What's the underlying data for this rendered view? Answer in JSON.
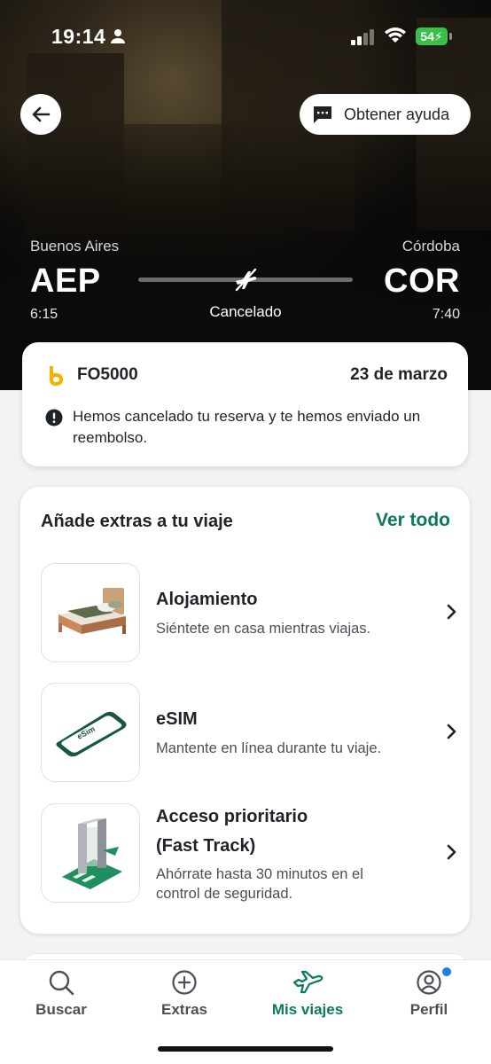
{
  "status_bar": {
    "time": "19:14",
    "battery": "54"
  },
  "header": {
    "help_label": "Obtener ayuda"
  },
  "route": {
    "from_city": "Buenos Aires",
    "from_code": "AEP",
    "from_time": "6:15",
    "to_city": "Córdoba",
    "to_code": "COR",
    "to_time": "7:40",
    "status": "Cancelado"
  },
  "booking": {
    "flight_number": "FO5000",
    "date": "23 de marzo",
    "message": "Hemos cancelado tu reserva y te hemos enviado un reembolso."
  },
  "extras": {
    "title": "Añade extras a tu viaje",
    "see_all": "Ver todo",
    "items": [
      {
        "name": "Alojamiento",
        "description": "Siéntete en casa mientras viajas.",
        "icon": "bed-icon"
      },
      {
        "name": "eSIM",
        "description": "Mantente en línea durante tu viaje.",
        "icon": "phone-esim-icon",
        "thumb_text": "eSim"
      },
      {
        "name_line1": "Acceso prioritario",
        "name_line2": "(Fast Track)",
        "description_line1": "Ahórrate hasta 30 minutos en el",
        "description_line2": "control de seguridad.",
        "icon": "security-gate-icon"
      }
    ]
  },
  "nav": {
    "items": [
      {
        "label": "Buscar",
        "icon": "search-icon"
      },
      {
        "label": "Extras",
        "icon": "plus-circle-icon"
      },
      {
        "label": "Mis viajes",
        "icon": "plane-icon",
        "active": true
      },
      {
        "label": "Perfil",
        "icon": "profile-icon"
      }
    ]
  },
  "colors": {
    "accent": "#0b7a5a",
    "notification": "#1c7fe6",
    "logo": "#f2b400"
  }
}
